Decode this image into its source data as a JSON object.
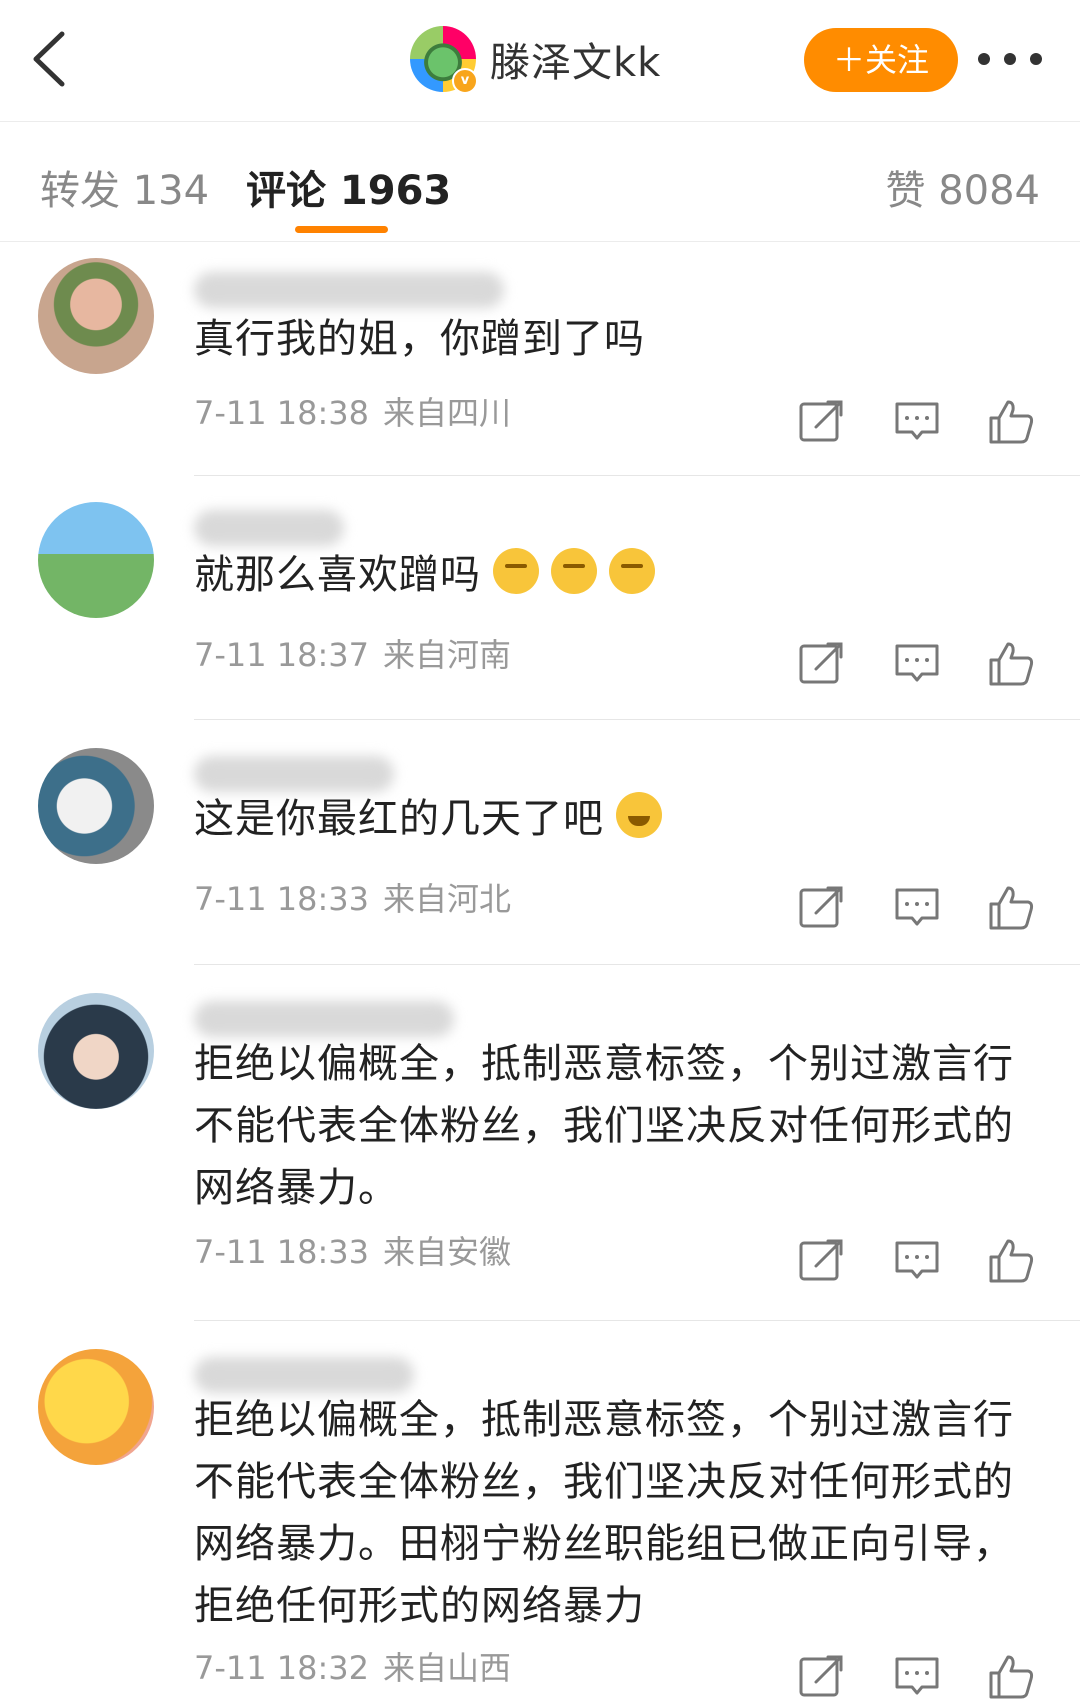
{
  "header": {
    "user_name": "滕泽文kk",
    "follow_label": "＋关注"
  },
  "tabs": {
    "repost": "转发 134",
    "comments": "评论 1963",
    "likes": "赞 8084"
  },
  "comments": [
    {
      "text": "真行我的姐，你蹭到了吗",
      "emojis": [],
      "time": "7-11 18:38",
      "location": "来自四川"
    },
    {
      "text": "就那么喜欢蹭吗",
      "emojis": [
        "smirk-emoji",
        "smirk-emoji",
        "smirk-emoji"
      ],
      "time": "7-11 18:37",
      "location": "来自河南"
    },
    {
      "text": "这是你最红的几天了吧",
      "emojis": [
        "laughing-tears-emoji"
      ],
      "time": "7-11 18:33",
      "location": "来自河北"
    },
    {
      "text": "拒绝以偏概全，抵制恶意标签，个别过激言行不能代表全体粉丝，我们坚决反对任何形式的网络暴力。",
      "emojis": [],
      "time": "7-11 18:33",
      "location": "来自安徽"
    },
    {
      "text": "拒绝以偏概全，抵制恶意标签，个别过激言行不能代表全体粉丝，我们坚决反对任何形式的网络暴力。田栩宁粉丝职能组已做正向引导，拒绝任何形式的网络暴力",
      "emojis": [],
      "time": "7-11 18:32",
      "location": "来自山西"
    }
  ],
  "icons": {
    "back": "chevron-left-icon",
    "more": "more-dots-icon",
    "share": "share-icon",
    "reply": "comment-icon",
    "like": "thumbs-up-icon"
  },
  "colors": {
    "accent": "#ff8200",
    "follow_bg": "#ff8c00"
  }
}
